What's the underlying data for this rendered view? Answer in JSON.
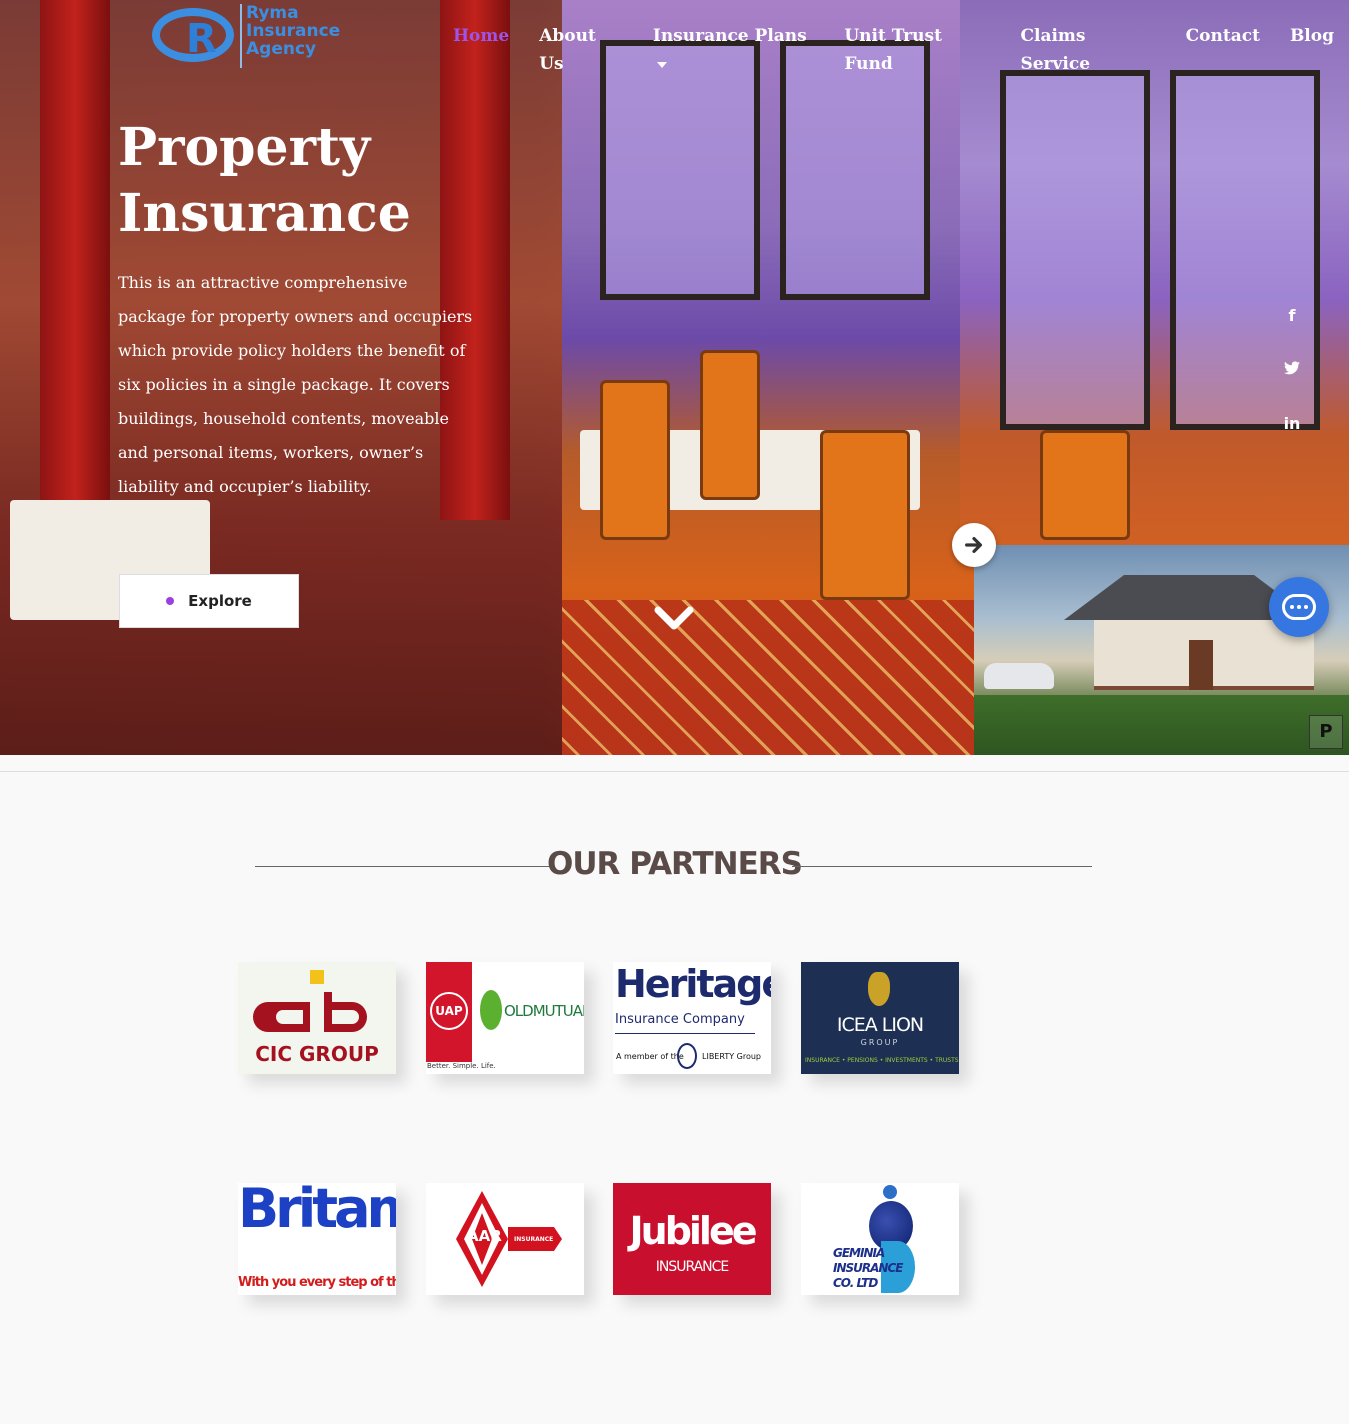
{
  "brand": {
    "logo_line1": "Ryma",
    "logo_line2": "Insurance",
    "logo_line3": "Agency",
    "logo_letter": "R"
  },
  "nav": {
    "items": [
      {
        "label": "Home",
        "active": true
      },
      {
        "label": "About Us"
      },
      {
        "label": "Insurance Plans",
        "dropdown": true
      },
      {
        "label": "Unit Trust Fund"
      },
      {
        "label": "Claims Service"
      },
      {
        "label": "Contact"
      },
      {
        "label": "Blog"
      }
    ]
  },
  "hero": {
    "title_line1": "Property",
    "title_line2": "Insurance",
    "description": "This is an attractive comprehensive package for property owners and occupiers which provide policy holders the benefit of six policies in a single package. It covers buildings, household contents, moveable and personal items, workers, owner’s liability and occupier’s liability.",
    "cta_label": "Explore"
  },
  "social": {
    "facebook": "f",
    "twitter": "🐦",
    "linkedin": "in"
  },
  "icons": {
    "next": "arrow-right-icon",
    "scroll": "chevron-down-icon",
    "chat": "chat-icon"
  },
  "partners": {
    "title": "OUR PARTNERS",
    "logos": [
      {
        "name": "CIC GROUP"
      },
      {
        "name": "UAP",
        "name2": "OLDMUTUAL",
        "tagline": "Better. Simple. Life."
      },
      {
        "name": "Heritage",
        "name2": "Insurance Company",
        "tagline": "A member of the",
        "tagline2": "LIBERTY Group"
      },
      {
        "name": "ICEA LION",
        "name2": "GROUP",
        "tagline": "INSURANCE • PENSIONS • INVESTMENTS • TRUSTS"
      },
      {
        "name": "Britam",
        "tagline": "With you every step of the way"
      },
      {
        "name": "AAR",
        "name2": "INSURANCE"
      },
      {
        "name": "Jubilee",
        "name2": "INSURANCE"
      },
      {
        "name": "GEMINIA",
        "name2": "INSURANCE",
        "name3": "CO. LTD"
      }
    ]
  },
  "colors": {
    "accent": "#9c55e8",
    "partners_title": "#5a4a48",
    "chat": "#3576e0"
  }
}
